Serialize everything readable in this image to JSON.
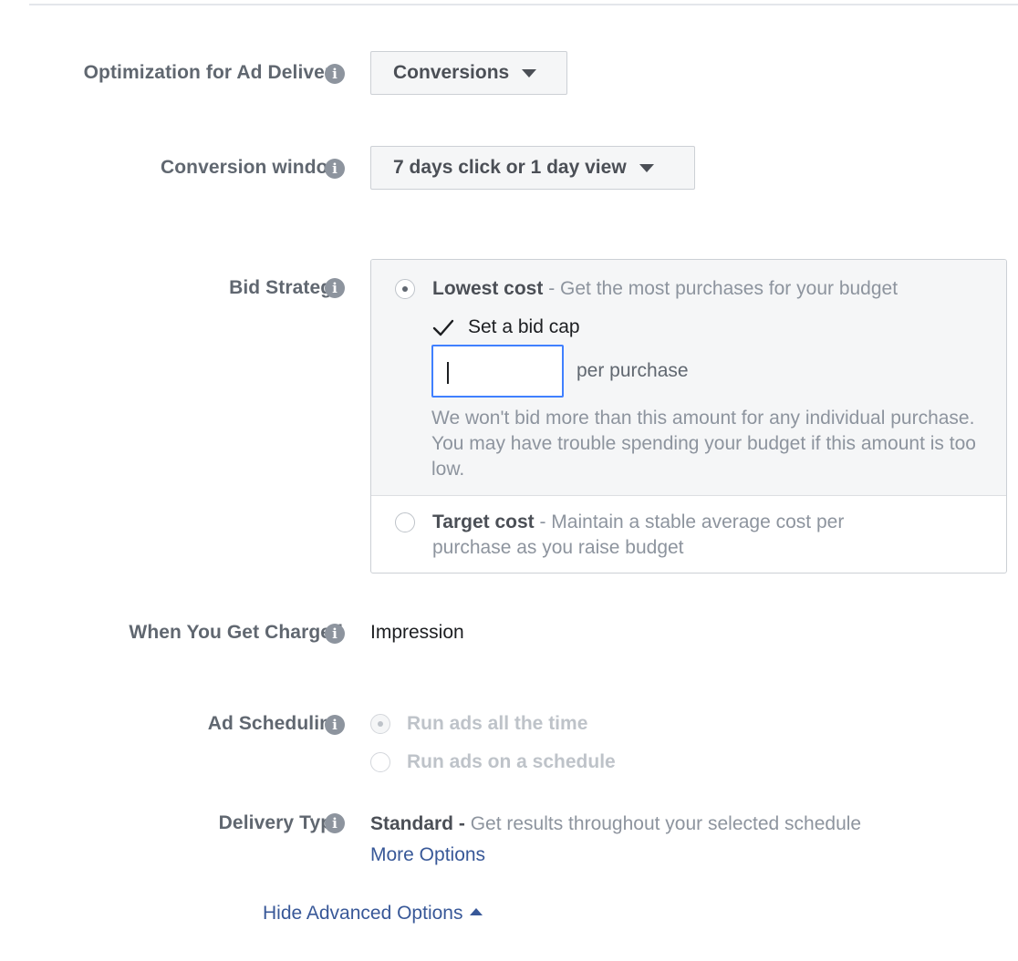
{
  "optimization": {
    "label": "Optimization for Ad Delivery",
    "value": "Conversions"
  },
  "conversion_window": {
    "label": "Conversion window",
    "value": "7 days click or 1 day view"
  },
  "bid_strategy": {
    "label": "Bid Strategy",
    "lowest_cost": {
      "title": "Lowest cost",
      "desc": " - Get the most purchases for your budget",
      "selected": true
    },
    "bid_cap": {
      "checkbox_label": "Set a bid cap",
      "checked": true,
      "input_value": "",
      "unit": "per purchase",
      "help": "We won't bid more than this amount for any individual purchase. You may have trouble spending your budget if this amount is too low."
    },
    "target_cost": {
      "title": "Target cost",
      "desc_line1": " - Maintain a stable average cost per",
      "desc_line2": "purchase as you raise budget",
      "selected": false
    }
  },
  "charged": {
    "label": "When You Get Charged",
    "value": "Impression"
  },
  "scheduling": {
    "label": "Ad Scheduling",
    "options": [
      {
        "label": "Run ads all the time",
        "selected": true
      },
      {
        "label": "Run ads on a schedule",
        "selected": false
      }
    ]
  },
  "delivery": {
    "label": "Delivery Type",
    "value": "Standard",
    "dash": " - ",
    "desc": "Get results throughout your selected schedule",
    "more_link": "More Options"
  },
  "footer": {
    "hide_advanced": "Hide Advanced Options"
  },
  "colors": {
    "link": "#385898",
    "focus": "#4080ff"
  },
  "icons": {
    "info": "info-circle-icon",
    "dropdown": "caret-down-icon",
    "toggle": "caret-up-icon"
  }
}
